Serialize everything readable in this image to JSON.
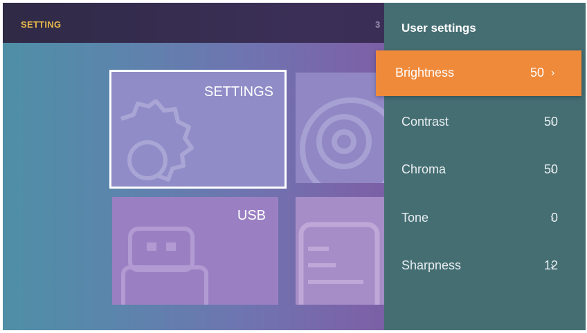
{
  "header": {
    "title": "SETTING",
    "clock_fragment": "3"
  },
  "tiles": {
    "settings": {
      "label": "SETTINGS",
      "icon": "gear-icon"
    },
    "usb": {
      "label": "USB",
      "icon": "usb-drive-icon"
    },
    "media": {
      "icon": "disc-icon"
    },
    "file": {
      "icon": "document-icon"
    }
  },
  "panel": {
    "title": "User settings",
    "items": [
      {
        "label": "Brightness",
        "value": "50",
        "chevron": "›",
        "selected": true
      },
      {
        "label": "Contrast",
        "value": "50",
        "chevron": "›"
      },
      {
        "label": "Chroma",
        "value": "50",
        "chevron": "›"
      },
      {
        "label": "Tone",
        "value": "0",
        "chevron": "›"
      },
      {
        "label": "Sharpness",
        "value": "12",
        "chevron": "›"
      }
    ]
  },
  "colors": {
    "accent": "#ef8a3b",
    "panel_bg": "#456e73",
    "header_text": "#e6b84a"
  }
}
